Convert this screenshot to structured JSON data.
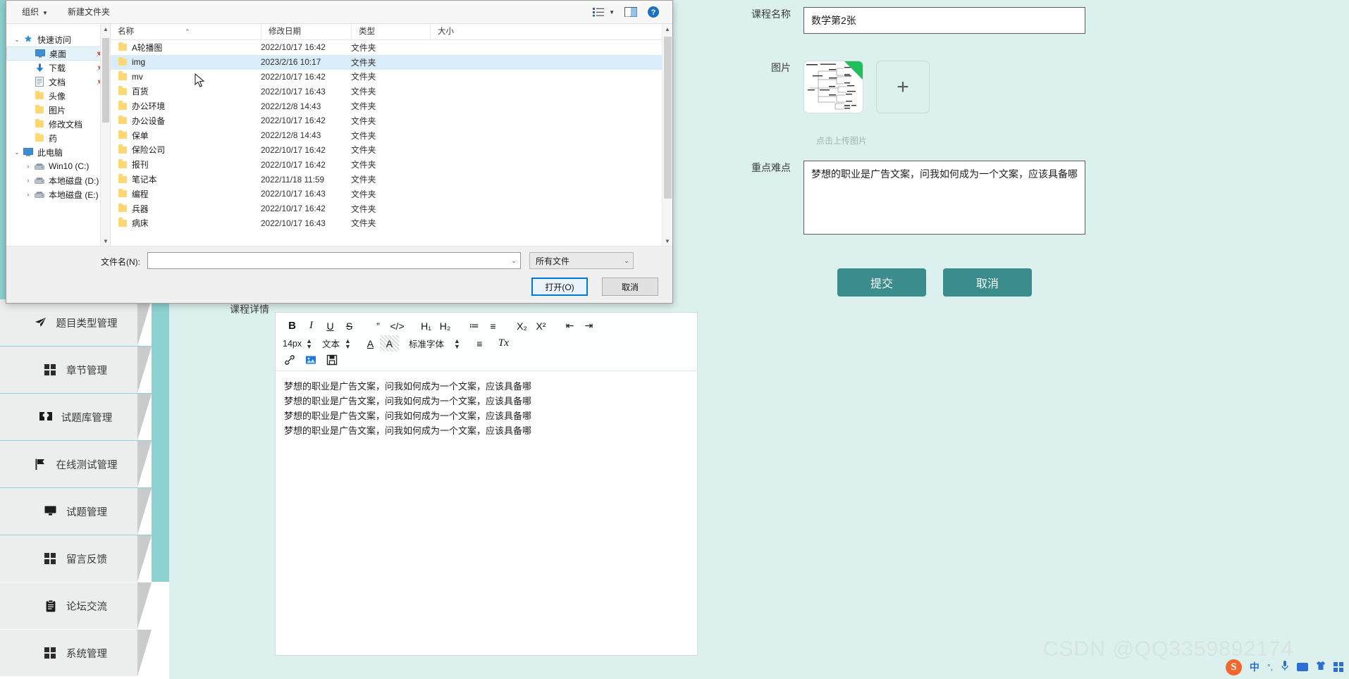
{
  "app": {
    "nav_items": [
      {
        "icon": "send-icon",
        "label": "题目类型管理"
      },
      {
        "icon": "grid-icon",
        "label": "章节管理"
      },
      {
        "icon": "ticket-icon",
        "label": "试题库管理"
      },
      {
        "icon": "flag-icon",
        "label": "在线测试管理"
      },
      {
        "icon": "monitor-icon",
        "label": "试题管理"
      },
      {
        "icon": "grid-icon",
        "label": "留言反馈"
      },
      {
        "icon": "clipboard-icon",
        "label": "论坛交流"
      },
      {
        "icon": "grid-icon",
        "label": "系统管理"
      }
    ],
    "detail_label": "课程详情"
  },
  "editor": {
    "toolbar_row1": [
      {
        "name": "bold-button",
        "glyph": "B"
      },
      {
        "name": "italic-button",
        "glyph": "I"
      },
      {
        "name": "underline-button",
        "glyph": "U"
      },
      {
        "name": "strikethrough-button",
        "glyph": "S"
      },
      {
        "name": "blockquote-button",
        "glyph": "”"
      },
      {
        "name": "code-button",
        "glyph": "</>"
      },
      {
        "name": "heading1-button",
        "glyph": "H₁"
      },
      {
        "name": "heading2-button",
        "glyph": "H₂"
      },
      {
        "name": "ordered-list-button",
        "glyph": "≔"
      },
      {
        "name": "unordered-list-button",
        "glyph": "≡"
      },
      {
        "name": "subscript-button",
        "glyph": "X₂"
      },
      {
        "name": "superscript-button",
        "glyph": "X²"
      },
      {
        "name": "outdent-button",
        "glyph": "⇤"
      },
      {
        "name": "indent-button",
        "glyph": "⇥"
      }
    ],
    "font_size": "14px",
    "text_style": "文本",
    "font_family": "标准字体",
    "color_icon": "A",
    "bgcolor_icon": "A",
    "align_icon": "≡",
    "clearformat_icon": "Tx",
    "row3": [
      {
        "name": "link-icon",
        "glyph": "🔗"
      },
      {
        "name": "image-icon",
        "glyph": "🖼"
      },
      {
        "name": "save-icon",
        "glyph": "💾"
      }
    ],
    "content_lines": [
      "梦想的职业是广告文案，问我如何成为一个文案，应该具备哪",
      "梦想的职业是广告文案，问我如何成为一个文案，应该具备哪",
      "梦想的职业是广告文案，问我如何成为一个文案，应该具备哪",
      "梦想的职业是广告文案，问我如何成为一个文案，应该具备哪"
    ]
  },
  "form": {
    "course_name_label": "课程名称",
    "course_name_value": "数学第2张",
    "image_label": "图片",
    "add_icon": "+",
    "upload_hint": "点击上传图片",
    "keypoint_label": "重点难点",
    "keypoint_value": "梦想的职业是广告文案，问我如何成为一个文案，应该具备哪",
    "submit_label": "提交",
    "cancel_label": "取消",
    "accent_color": "#3b8c8c"
  },
  "dialog": {
    "toolbar": {
      "organize_label": "组织",
      "new_folder_label": "新建文件夹",
      "view_icon": "view-list-icon",
      "pane_icon": "preview-pane-icon",
      "help_icon": "help-icon"
    },
    "tree": [
      {
        "chevron": "v",
        "icon": "star-icon",
        "label": "快速访问",
        "indent": 0,
        "selected": false,
        "pinned": false
      },
      {
        "chevron": "",
        "icon": "desktop-icon",
        "label": "桌面",
        "indent": 1,
        "selected": true,
        "pinned": true
      },
      {
        "chevron": "",
        "icon": "download-icon",
        "label": "下载",
        "indent": 1,
        "selected": false,
        "pinned": true
      },
      {
        "chevron": "",
        "icon": "document-icon",
        "label": "文档",
        "indent": 1,
        "selected": false,
        "pinned": true
      },
      {
        "chevron": "",
        "icon": "folder-icon",
        "label": "头像",
        "indent": 1,
        "selected": false,
        "pinned": false
      },
      {
        "chevron": "",
        "icon": "folder-icon",
        "label": "图片",
        "indent": 1,
        "selected": false,
        "pinned": false
      },
      {
        "chevron": "",
        "icon": "folder-icon",
        "label": "修改文档",
        "indent": 1,
        "selected": false,
        "pinned": false
      },
      {
        "chevron": "",
        "icon": "folder-icon",
        "label": "药",
        "indent": 1,
        "selected": false,
        "pinned": false
      },
      {
        "chevron": "v",
        "icon": "pc-icon",
        "label": "此电脑",
        "indent": 0,
        "selected": false,
        "pinned": false
      },
      {
        "chevron": ">",
        "icon": "drive-icon",
        "label": "Win10 (C:)",
        "indent": 1,
        "selected": false,
        "pinned": false
      },
      {
        "chevron": ">",
        "icon": "drive-icon",
        "label": "本地磁盘 (D:)",
        "indent": 1,
        "selected": false,
        "pinned": false
      },
      {
        "chevron": ">",
        "icon": "drive-icon",
        "label": "本地磁盘 (E:)",
        "indent": 1,
        "selected": false,
        "pinned": false
      }
    ],
    "columns": [
      "名称",
      "修改日期",
      "类型",
      "大小"
    ],
    "rows": [
      {
        "name": "A轮播图",
        "date": "2022/10/17 16:42",
        "type": "文件夹",
        "size": "",
        "selected": false
      },
      {
        "name": "img",
        "date": "2023/2/16 10:17",
        "type": "文件夹",
        "size": "",
        "selected": true
      },
      {
        "name": "mv",
        "date": "2022/10/17 16:42",
        "type": "文件夹",
        "size": "",
        "selected": false
      },
      {
        "name": "百货",
        "date": "2022/10/17 16:43",
        "type": "文件夹",
        "size": "",
        "selected": false
      },
      {
        "name": "办公环境",
        "date": "2022/12/8 14:43",
        "type": "文件夹",
        "size": "",
        "selected": false
      },
      {
        "name": "办公设备",
        "date": "2022/10/17 16:42",
        "type": "文件夹",
        "size": "",
        "selected": false
      },
      {
        "name": "保单",
        "date": "2022/12/8 14:43",
        "type": "文件夹",
        "size": "",
        "selected": false
      },
      {
        "name": "保险公司",
        "date": "2022/10/17 16:42",
        "type": "文件夹",
        "size": "",
        "selected": false
      },
      {
        "name": "报刊",
        "date": "2022/10/17 16:42",
        "type": "文件夹",
        "size": "",
        "selected": false
      },
      {
        "name": "笔记本",
        "date": "2022/11/18 11:59",
        "type": "文件夹",
        "size": "",
        "selected": false
      },
      {
        "name": "编程",
        "date": "2022/10/17 16:43",
        "type": "文件夹",
        "size": "",
        "selected": false
      },
      {
        "name": "兵器",
        "date": "2022/10/17 16:42",
        "type": "文件夹",
        "size": "",
        "selected": false
      },
      {
        "name": "病床",
        "date": "2022/10/17 16:43",
        "type": "文件夹",
        "size": "",
        "selected": false
      }
    ],
    "footer": {
      "filename_label": "文件名(N):",
      "filename_value": "",
      "filetype_value": "所有文件",
      "open_label": "打开(O)",
      "cancel_label": "取消"
    }
  },
  "watermark": "CSDN @QQ3359892174",
  "tray": {
    "items": [
      {
        "name": "sogou-input-icon",
        "glyph": "S"
      },
      {
        "name": "chinese-mode-icon",
        "glyph": "中"
      },
      {
        "name": "punctuation-icon",
        "glyph": "°,"
      },
      {
        "name": "microphone-icon",
        "glyph": "🎤"
      },
      {
        "name": "keyboard-icon",
        "glyph": "⌨"
      },
      {
        "name": "skin-icon",
        "glyph": "👕"
      },
      {
        "name": "toolbox-icon",
        "glyph": "▦"
      }
    ]
  }
}
